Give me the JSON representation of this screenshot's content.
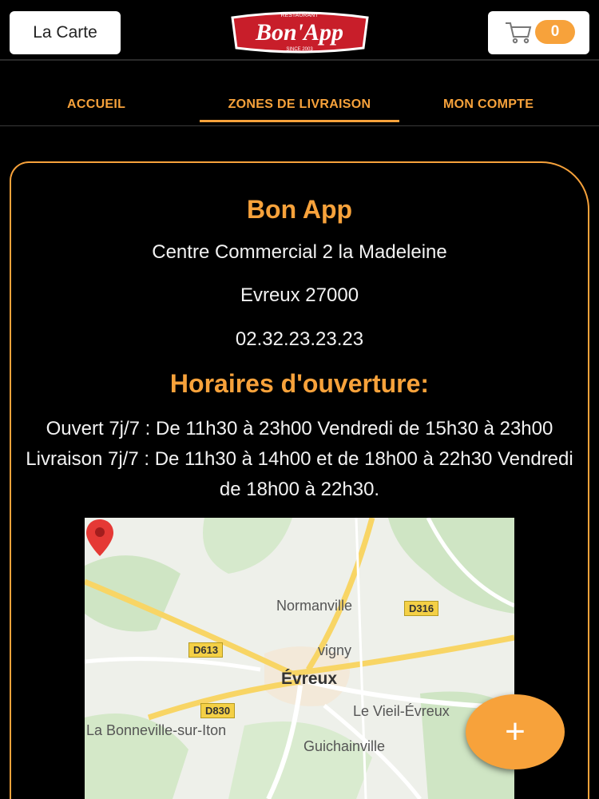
{
  "header": {
    "menu_button": "La Carte",
    "logo": {
      "small_top": "RESTAURANT",
      "main": "Bon'App",
      "small_bottom": "SINCE 2003"
    },
    "cart_count": "0"
  },
  "nav": {
    "tabs": [
      {
        "label": "ACCUEIL"
      },
      {
        "label": "ZONES DE LIVRAISON"
      },
      {
        "label": "MON COMPTE"
      }
    ]
  },
  "restaurant": {
    "name": "Bon App",
    "address_line1": "Centre Commercial 2 la Madeleine",
    "address_line2": "Evreux 27000",
    "phone": "02.32.23.23.23",
    "hours_title": "Horaires d'ouverture:",
    "hours_text": "Ouvert 7j/7 : De 11h30 à 23h00 Vendredi de 15h30 à 23h00  Livraison 7j/7 : De 11h30 à 14h00 et de 18h00 à 22h30 Vendredi de 18h00 à 22h30."
  },
  "map": {
    "labels": {
      "normanville": "Normanville",
      "gravigny": "vigny",
      "evreux": "Évreux",
      "vieil_evreux": "Le Vieil-Évreux",
      "bonneville": "La Bonneville-sur-Iton",
      "guichainville": "Guichainville"
    },
    "roads": {
      "d316": "D316",
      "d613": "D613",
      "d830": "D830"
    }
  },
  "fab_symbol": "+",
  "colors": {
    "accent": "#f7a23b",
    "background": "#000000",
    "logo_red": "#c81e2a"
  }
}
